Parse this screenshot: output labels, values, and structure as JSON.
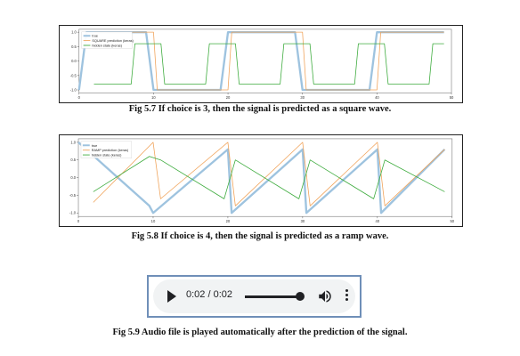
{
  "figures": [
    {
      "caption": "Fig 5.7 If choice is 3, then the signal is predicted as a square wave.",
      "chart_data": {
        "type": "line",
        "xlim": [
          0,
          50
        ],
        "ylim": [
          -1.1,
          1.1
        ],
        "x_ticks": [
          "0",
          "10",
          "20",
          "30",
          "40",
          "50"
        ],
        "y_ticks": [
          "1.0",
          "0.5",
          "0.0",
          "-0.5",
          "-1.0"
        ],
        "legend_position": "top-left",
        "series": [
          {
            "name": "true",
            "color": "#9ec3df",
            "x": [
              0,
              1,
              2,
              9,
              10,
              11,
              12,
              19,
              20,
              21,
              22,
              29,
              30,
              31,
              32,
              39,
              40,
              41,
              42,
              49
            ],
            "y": [
              -1,
              1,
              1,
              1,
              -1,
              -1,
              -1,
              -1,
              1,
              1,
              1,
              1,
              -1,
              -1,
              -1,
              -1,
              1,
              1,
              1,
              1
            ]
          },
          {
            "name": "SQUARE prediction (keras)",
            "color": "#f0a35a",
            "x": [
              2,
              9,
              10,
              10.5,
              11,
              19,
              20,
              20.5,
              21,
              29,
              30,
              30.5,
              31,
              39,
              40,
              40.5,
              41,
              49
            ],
            "y": [
              1,
              1,
              1,
              -1,
              -1,
              -1,
              -1,
              1,
              1,
              1,
              1,
              -1,
              -1,
              -1,
              -1,
              1,
              1,
              1
            ]
          },
          {
            "name": "hidden state (keras)",
            "color": "#3cab3c",
            "x": [
              2,
              7,
              7.5,
              11,
              11.5,
              17,
              17.5,
              21,
              21.5,
              27,
              27.5,
              31,
              31.5,
              37,
              37.5,
              41,
              41.5,
              47,
              47.5,
              49
            ],
            "y": [
              -0.8,
              -0.8,
              0.6,
              0.6,
              -0.8,
              -0.8,
              0.6,
              0.6,
              -0.8,
              -0.8,
              0.6,
              0.6,
              -0.8,
              -0.8,
              0.6,
              0.6,
              -0.8,
              -0.8,
              0.6,
              0.6
            ]
          }
        ]
      }
    },
    {
      "caption": "Fig 5.8 If choice is 4, then the signal is predicted as a ramp wave.",
      "chart_data": {
        "type": "line",
        "xlim": [
          0,
          50
        ],
        "ylim": [
          -1.1,
          1.1
        ],
        "x_ticks": [
          "0",
          "10",
          "20",
          "30",
          "40",
          "50"
        ],
        "y_ticks": [
          "1.0",
          "0.5",
          "0.0",
          "-0.5",
          "-1.0"
        ],
        "legend_position": "top-left",
        "series": [
          {
            "name": "true",
            "color": "#9ec3df",
            "x": [
              0,
              9.5,
              10,
              20,
              20.5,
              30,
              30.5,
              40,
              40.5,
              49
            ],
            "y": [
              1,
              -0.8,
              -1,
              0.8,
              -1,
              0.8,
              -1,
              0.8,
              -1,
              0.8
            ]
          },
          {
            "name": "RAMP prediction (keras)",
            "color": "#f0a35a",
            "x": [
              2,
              10,
              11,
              20,
              21,
              30,
              31,
              40,
              41,
              49
            ],
            "y": [
              -0.7,
              1,
              -0.6,
              1,
              -0.8,
              1,
              -0.8,
              1,
              -0.8,
              0.8
            ]
          },
          {
            "name": "hidden state (keras)",
            "color": "#3cab3c",
            "x": [
              2,
              9.5,
              11,
              19.5,
              21,
              29.5,
              31,
              39.5,
              41,
              49
            ],
            "y": [
              -0.4,
              0.6,
              0.5,
              -0.6,
              0.5,
              -0.6,
              0.5,
              -0.6,
              0.5,
              -0.4
            ]
          }
        ]
      }
    }
  ],
  "audio": {
    "time_display": "0:02 / 0:02",
    "progress": 1.0,
    "play_icon": "play-icon",
    "volume_icon": "volume-icon",
    "more_icon": "more-options-icon"
  },
  "audio_caption": "Fig 5.9 Audio file is played automatically after the prediction of the signal."
}
